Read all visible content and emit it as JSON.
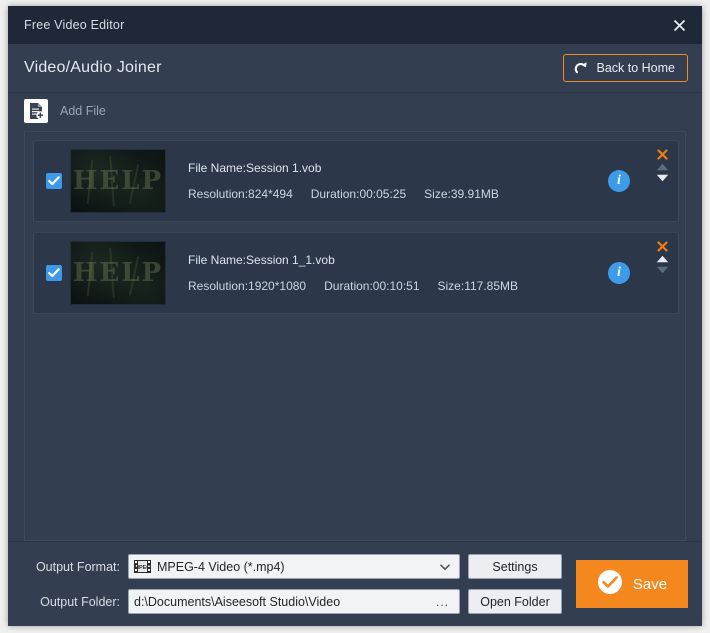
{
  "window": {
    "title": "Free Video Editor",
    "close_icon": "close-icon"
  },
  "header": {
    "page_title": "Video/Audio Joiner",
    "back_home_label": "Back to Home",
    "back_home_icon": "redo-arrow-icon"
  },
  "toolbar": {
    "add_file_label": "Add File",
    "add_file_icon": "add-file-icon"
  },
  "file_list": {
    "items": [
      {
        "checked": true,
        "file_name": "File Name:Session 1.vob",
        "resolution": "Resolution:824*494",
        "duration": "Duration:00:05:25",
        "size": "Size:39.91MB",
        "thumb_text": "HELP",
        "info_icon": "info-icon",
        "delete_icon": "close-x-icon",
        "move_up_enabled": false,
        "move_down_enabled": true
      },
      {
        "checked": true,
        "file_name": "File Name:Session 1_1.vob",
        "resolution": "Resolution:1920*1080",
        "duration": "Duration:00:10:51",
        "size": "Size:117.85MB",
        "thumb_text": "HELP",
        "info_icon": "info-icon",
        "delete_icon": "close-x-icon",
        "move_up_enabled": true,
        "move_down_enabled": false
      }
    ]
  },
  "output": {
    "format_label": "Output Format:",
    "format_value": "MPEG-4 Video (*.mp4)",
    "format_icon": "film-strip-icon",
    "settings_label": "Settings",
    "folder_label": "Output Folder:",
    "folder_value": "d:\\Documents\\Aiseesoft Studio\\Video",
    "browse_label": "...",
    "open_folder_label": "Open Folder",
    "save_label": "Save",
    "save_icon": "check-circle-icon"
  },
  "colors": {
    "accent_orange": "#f5871f",
    "window_bg": "#333f50",
    "titlebar_bg": "#1f2836",
    "row_bg": "#2c384a",
    "info_blue": "#3d9bea"
  }
}
